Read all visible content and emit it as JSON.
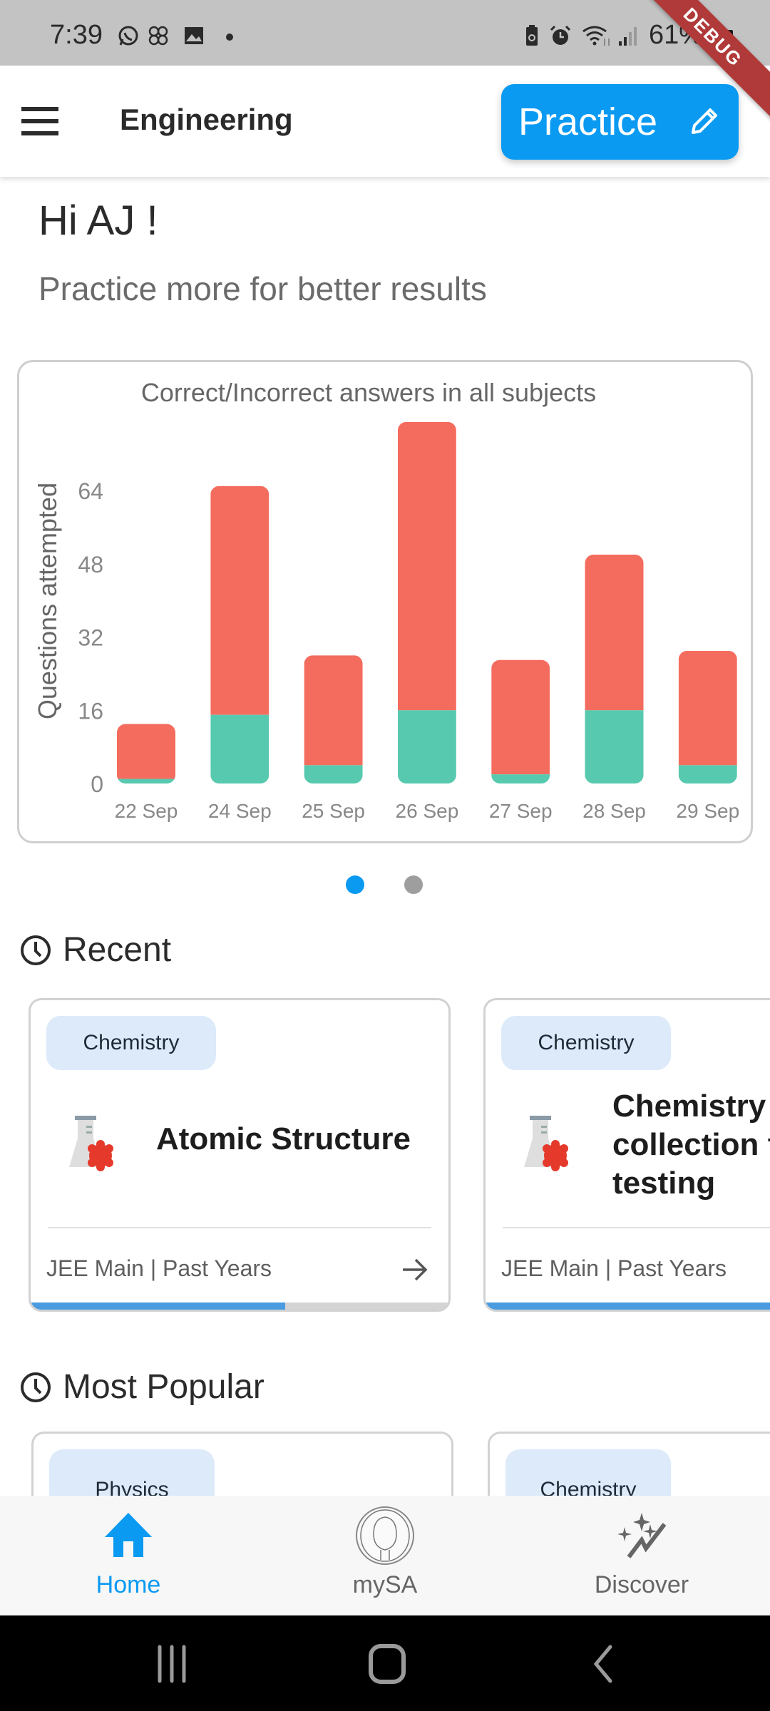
{
  "status_bar": {
    "time": "7:39",
    "battery": "61%",
    "left_icons": [
      "whatsapp-icon",
      "pinwheel-icon",
      "gallery-icon",
      "dot-icon"
    ],
    "right_icons": [
      "battery-saver-icon",
      "alarm-icon",
      "wifi-icon",
      "signal-icon",
      "battery-icon"
    ],
    "debug_banner": "DEBUG"
  },
  "app_bar": {
    "menu_icon": "hamburger-menu-icon",
    "title": "Engineering",
    "practice_button": "Practice",
    "practice_icon": "pencil-icon"
  },
  "greeting": {
    "title": "Hi AJ !",
    "subtitle": "Practice more for better results"
  },
  "chart_data": {
    "type": "bar",
    "stacked": true,
    "title": "Correct/Incorrect answers in all subjects",
    "xlabel": "",
    "ylabel": "Questions attempted",
    "categories": [
      "22 Sep",
      "24 Sep",
      "25 Sep",
      "26 Sep",
      "27 Sep",
      "28 Sep",
      "29 Sep"
    ],
    "series": [
      {
        "name": "Correct",
        "color": "#57C9AE",
        "values": [
          1,
          15,
          4,
          16,
          2,
          16,
          4
        ]
      },
      {
        "name": "Incorrect",
        "color": "#F46C5E",
        "values": [
          12,
          50,
          24,
          63,
          25,
          34,
          25
        ]
      }
    ],
    "totals": [
      13,
      65,
      28,
      79,
      27,
      50,
      29
    ],
    "yticks": [
      0,
      16,
      32,
      48,
      64
    ],
    "ylim": [
      0,
      80
    ],
    "grid": false,
    "legend": "none"
  },
  "carousel": {
    "pages": 2,
    "active_index": 0,
    "active_color": "#0A9AF2",
    "inactive_color": "#9E9E9E"
  },
  "recent": {
    "heading": "Recent",
    "icon": "clock-icon",
    "cards": [
      {
        "subject": "Chemistry",
        "title": "Atomic Structure",
        "footer": "JEE Main | Past Years",
        "progress": 0.61,
        "icon": "chemistry-flask-icon"
      },
      {
        "subject": "Chemistry",
        "title": "Chemistry collection f testing",
        "title_lines": [
          "Chemistry",
          "collection f",
          "testing"
        ],
        "footer": "JEE Main | Past Years",
        "progress": 1.0,
        "icon": "chemistry-flask-icon"
      }
    ]
  },
  "most_popular": {
    "heading": "Most Popular",
    "icon": "clock-icon",
    "cards": [
      {
        "subject": "Physics"
      },
      {
        "subject": "Chemistry"
      }
    ]
  },
  "bottom_nav": {
    "active": "Home",
    "active_color": "#0A9AF2",
    "items": [
      {
        "label": "Home",
        "icon": "home-icon"
      },
      {
        "label": "mySA",
        "icon": "avatar-icon"
      },
      {
        "label": "Discover",
        "icon": "discover-sparkle-icon"
      }
    ]
  },
  "system_nav": {
    "buttons": [
      "recents-icon",
      "home-circle-icon",
      "back-icon"
    ]
  }
}
